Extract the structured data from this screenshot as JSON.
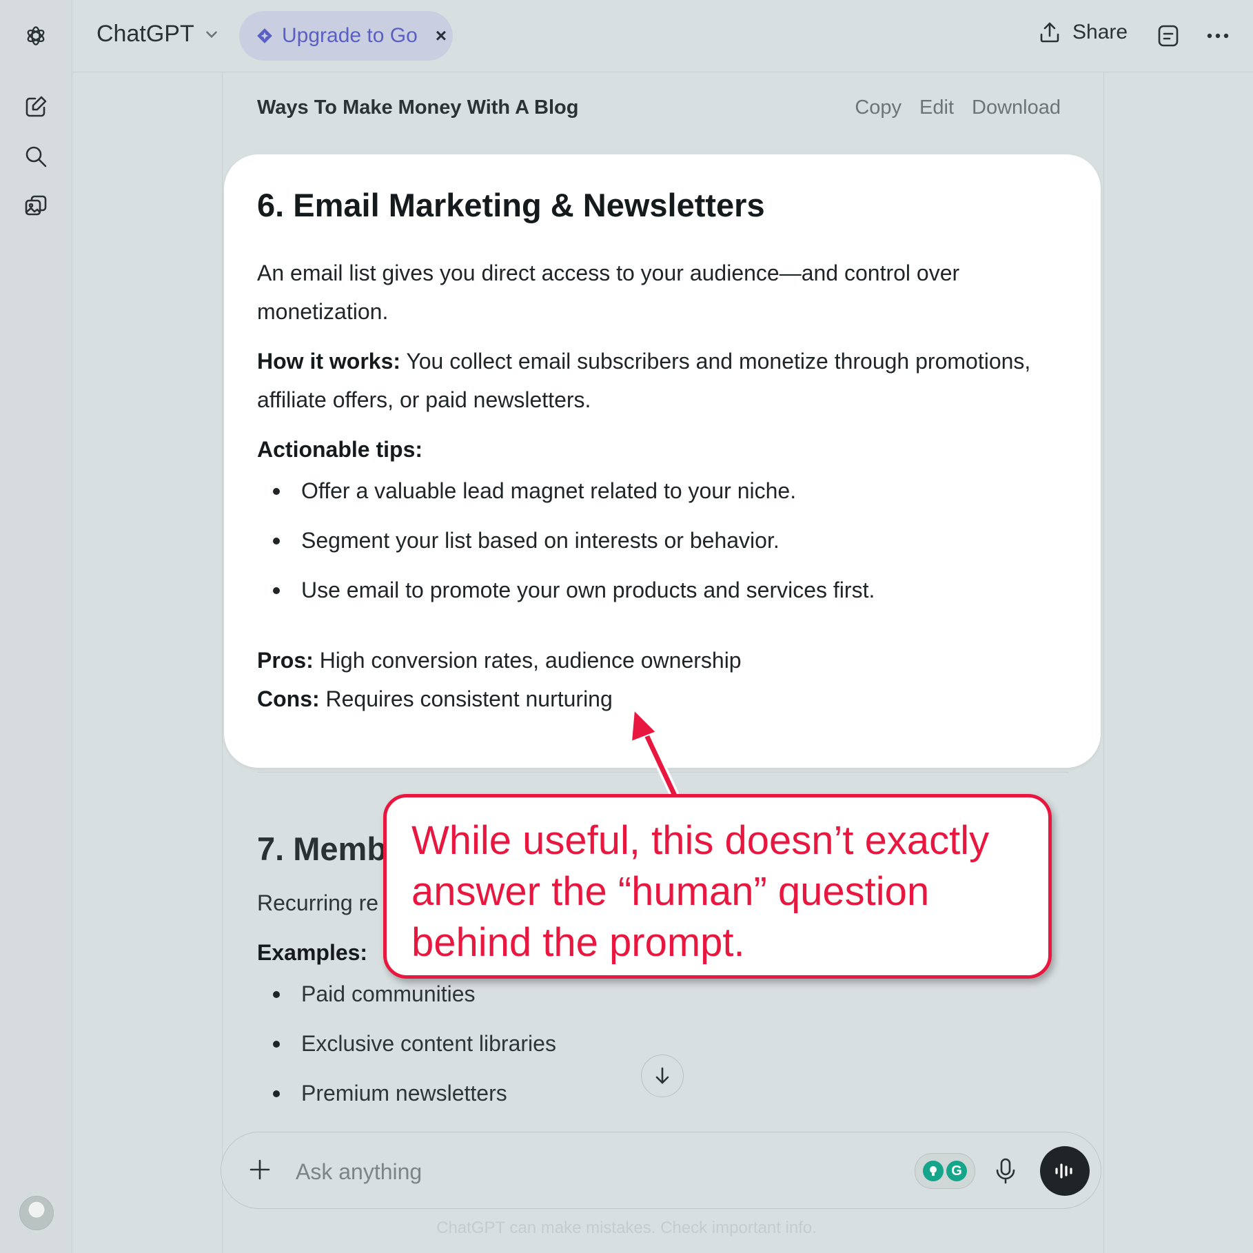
{
  "app": {
    "title": "ChatGPT",
    "upgrade_label": "Upgrade to Go",
    "upgrade_close": "×",
    "share_label": "Share"
  },
  "sidebar": {
    "icons": [
      "openai-logo-icon",
      "new-chat-icon",
      "search-icon",
      "images-icon"
    ]
  },
  "document": {
    "title": "Ways To Make Money With A Blog",
    "actions": {
      "copy": "Copy",
      "edit": "Edit",
      "download": "Download"
    },
    "section6": {
      "heading": "6. Email Marketing & Newsletters",
      "intro_line1": "An email list gives you direct access to your audience—and control over",
      "intro_line2": "monetization.",
      "how_label": "How it works:",
      "how_text_line1": " You collect email subscribers and monetize through promotions,",
      "how_text_line2": "affiliate offers, or paid newsletters.",
      "tips_label": "Actionable tips:",
      "tips": [
        "Offer a valuable lead magnet related to your niche.",
        "Segment your list based on interests or behavior.",
        "Use email to promote your own products and services first."
      ],
      "pros_label": "Pros:",
      "pros_text": " High conversion rates, audience ownership",
      "cons_label": "Cons:",
      "cons_text": " Requires consistent nurturing"
    },
    "section7": {
      "heading": "7. Memb",
      "intro": "Recurring re",
      "examples_label": "Examples:",
      "examples": [
        "Paid communities",
        "Exclusive content libraries",
        "Premium newsletters"
      ]
    }
  },
  "composer": {
    "placeholder": "Ask anything",
    "grammarly_letter": "G"
  },
  "disclaimer": "ChatGPT can make mistakes. Check important info.",
  "annotation": {
    "line1": "While useful, this doesn’t exactly",
    "line2": "answer the “human” question",
    "line3": "behind the prompt.",
    "color": "#e8173f"
  },
  "colors": {
    "background": "#d8dfe0",
    "card": "#ffffff",
    "upgrade_accent": "#5a5fc4",
    "annotation_red": "#e8173f"
  }
}
